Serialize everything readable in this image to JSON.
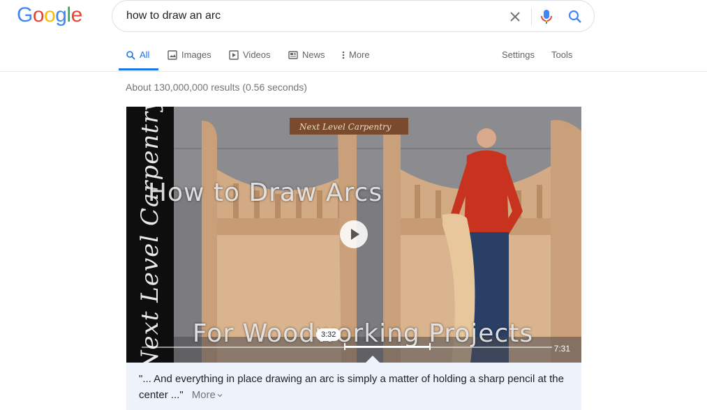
{
  "logo": {
    "letters": [
      {
        "ch": "G",
        "color": "#4285f4"
      },
      {
        "ch": "o",
        "color": "#ea4335"
      },
      {
        "ch": "o",
        "color": "#fbbc05"
      },
      {
        "ch": "g",
        "color": "#4285f4"
      },
      {
        "ch": "l",
        "color": "#34a853"
      },
      {
        "ch": "e",
        "color": "#ea4335"
      }
    ]
  },
  "search": {
    "query": "how to draw an arc"
  },
  "tabs": [
    {
      "label": "All",
      "icon": "search-icon"
    },
    {
      "label": "Images",
      "icon": "image-icon"
    },
    {
      "label": "Videos",
      "icon": "play-icon"
    },
    {
      "label": "News",
      "icon": "newspaper-icon"
    },
    {
      "label": "More",
      "icon": "more-vert-icon"
    }
  ],
  "tools": {
    "settings": "Settings",
    "tools": "Tools"
  },
  "result_stats": "About 130,000,000 results (0.56 seconds)",
  "video": {
    "channel_brand": "Next Level Carpentry",
    "sign_text": "Next Level Carpentry",
    "title_line1": "How to Draw Arcs",
    "title_line2": "For Woodworking Projects",
    "current_time": "3:32",
    "duration": "7:31"
  },
  "snippet": {
    "text": "\"... And everything in place drawing an arc is simply a matter of holding a sharp pencil at the center ...\"",
    "more": "More"
  },
  "colors": {
    "accent": "#1a73e8",
    "snippet_bg": "#eef2fb"
  }
}
